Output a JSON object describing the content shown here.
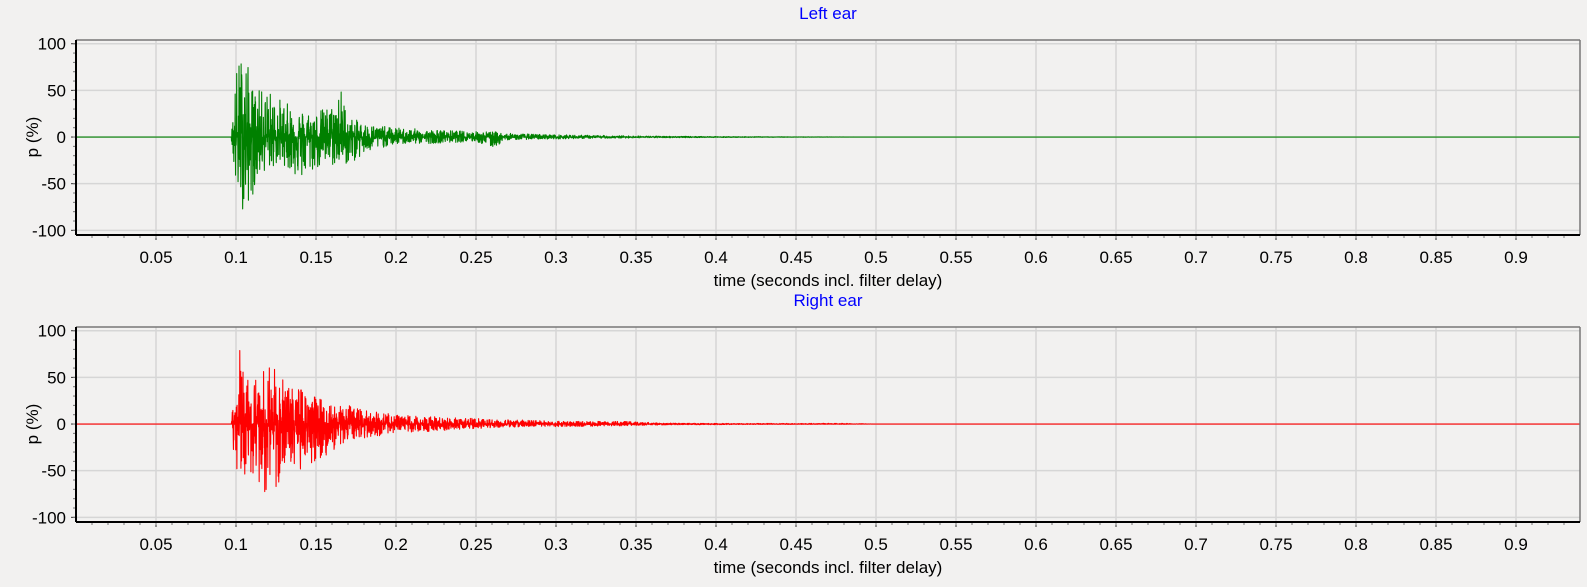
{
  "chart_data": [
    {
      "type": "line",
      "title": "Left ear",
      "xlabel": "time (seconds incl. filter delay)",
      "ylabel": "p (%)",
      "xlim": [
        0,
        0.94
      ],
      "ylim": [
        -105,
        104
      ],
      "xticks": [
        0.05,
        0.1,
        0.15,
        0.2,
        0.25,
        0.3,
        0.35,
        0.4,
        0.45,
        0.5,
        0.55,
        0.6,
        0.65,
        0.7,
        0.75,
        0.8,
        0.85,
        0.9
      ],
      "xtick_labels": [
        "0.05",
        "0.1",
        "0.15",
        "0.2",
        "0.25",
        "0.3",
        "0.35",
        "0.4",
        "0.45",
        "0.5",
        "0.55",
        "0.6",
        "0.65",
        "0.7",
        "0.75",
        "0.8",
        "0.85",
        "0.9"
      ],
      "yticks": [
        100,
        50,
        0,
        -50,
        -100
      ],
      "ytick_labels": [
        "100",
        "50",
        "0",
        "-50",
        "-100"
      ],
      "grid": true,
      "color": "#008000",
      "envelope": {
        "t": [
          0,
          0.097,
          0.1,
          0.105,
          0.11,
          0.115,
          0.12,
          0.13,
          0.14,
          0.15,
          0.16,
          0.165,
          0.17,
          0.18,
          0.19,
          0.2,
          0.22,
          0.25,
          0.26,
          0.27,
          0.3,
          0.35,
          0.4,
          0.45,
          0.5,
          0.94
        ],
        "max": [
          0,
          0,
          75,
          100,
          55,
          50,
          52,
          38,
          30,
          28,
          35,
          58,
          22,
          15,
          12,
          10,
          8,
          6,
          6,
          4,
          2.5,
          1.2,
          0.5,
          0.2,
          0,
          0
        ],
        "min": [
          0,
          0,
          -65,
          -80,
          -65,
          -40,
          -35,
          -30,
          -48,
          -35,
          -32,
          -30,
          -30,
          -20,
          -12,
          -8,
          -7,
          -5,
          -12,
          -3,
          -2,
          -1,
          -0.5,
          -0.2,
          0,
          0
        ]
      }
    },
    {
      "type": "line",
      "title": "Right ear",
      "xlabel": "time (seconds incl. filter delay)",
      "ylabel": "p (%)",
      "xlim": [
        0,
        0.94
      ],
      "ylim": [
        -105,
        104
      ],
      "xticks": [
        0.05,
        0.1,
        0.15,
        0.2,
        0.25,
        0.3,
        0.35,
        0.4,
        0.45,
        0.5,
        0.55,
        0.6,
        0.65,
        0.7,
        0.75,
        0.8,
        0.85,
        0.9
      ],
      "xtick_labels": [
        "0.05",
        "0.1",
        "0.15",
        "0.2",
        "0.25",
        "0.3",
        "0.35",
        "0.4",
        "0.45",
        "0.5",
        "0.55",
        "0.6",
        "0.65",
        "0.7",
        "0.75",
        "0.8",
        "0.85",
        "0.9"
      ],
      "yticks": [
        100,
        50,
        0,
        -50,
        -100
      ],
      "ytick_labels": [
        "100",
        "50",
        "0",
        "-50",
        "-100"
      ],
      "grid": true,
      "color": "#ff0000",
      "envelope": {
        "t": [
          0,
          0.097,
          0.1,
          0.104,
          0.11,
          0.115,
          0.12,
          0.125,
          0.13,
          0.14,
          0.15,
          0.16,
          0.17,
          0.18,
          0.2,
          0.22,
          0.25,
          0.27,
          0.3,
          0.34,
          0.37,
          0.42,
          0.48,
          0.5,
          0.94
        ],
        "max": [
          0,
          0,
          65,
          95,
          50,
          55,
          68,
          60,
          45,
          40,
          30,
          25,
          20,
          15,
          10,
          8,
          6,
          5,
          3,
          3,
          1,
          0.6,
          0.8,
          0,
          0
        ],
        "min": [
          0,
          0,
          -60,
          -60,
          -55,
          -65,
          -80,
          -75,
          -60,
          -50,
          -40,
          -30,
          -18,
          -15,
          -10,
          -8,
          -5,
          -4,
          -3,
          -2,
          -1,
          -0.5,
          -0.3,
          0,
          0
        ]
      }
    }
  ]
}
